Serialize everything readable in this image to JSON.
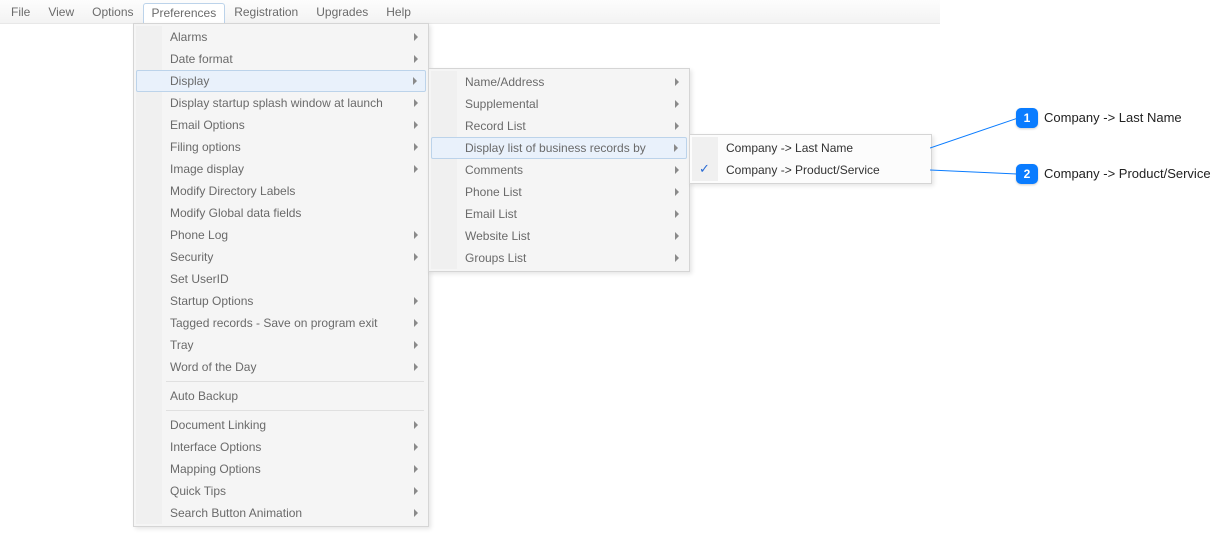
{
  "menubar": {
    "items": [
      {
        "label": "File"
      },
      {
        "label": "View"
      },
      {
        "label": "Options"
      },
      {
        "label": "Preferences",
        "active": true
      },
      {
        "label": "Registration"
      },
      {
        "label": "Upgrades"
      },
      {
        "label": "Help"
      }
    ]
  },
  "prefs_menu": {
    "items": [
      {
        "label": "Alarms",
        "arrow": true
      },
      {
        "label": "Date format",
        "arrow": true
      },
      {
        "label": "Display",
        "arrow": true,
        "highlight": true
      },
      {
        "label": "Display startup splash window at launch",
        "arrow": true
      },
      {
        "label": "Email Options",
        "arrow": true
      },
      {
        "label": "Filing options",
        "arrow": true
      },
      {
        "label": "Image display",
        "arrow": true
      },
      {
        "label": "Modify Directory Labels"
      },
      {
        "label": "Modify Global data fields"
      },
      {
        "label": "Phone Log",
        "arrow": true
      },
      {
        "label": "Security",
        "arrow": true
      },
      {
        "label": "Set UserID"
      },
      {
        "label": "Startup Options",
        "arrow": true
      },
      {
        "label": "Tagged records - Save on program exit",
        "arrow": true
      },
      {
        "label": "Tray",
        "arrow": true
      },
      {
        "label": "Word of the Day",
        "arrow": true
      }
    ],
    "items2": [
      {
        "label": "Auto Backup"
      }
    ],
    "items3": [
      {
        "label": "Document Linking",
        "arrow": true
      },
      {
        "label": "Interface Options",
        "arrow": true
      },
      {
        "label": "Mapping Options",
        "arrow": true
      },
      {
        "label": "Quick Tips",
        "arrow": true
      },
      {
        "label": "Search Button Animation",
        "arrow": true
      }
    ]
  },
  "display_menu": {
    "items": [
      {
        "label": "Name/Address",
        "arrow": true
      },
      {
        "label": "Supplemental",
        "arrow": true
      },
      {
        "label": "Record List",
        "arrow": true
      },
      {
        "label": "Display list of business records by",
        "arrow": true,
        "highlight": true
      },
      {
        "label": "Comments",
        "arrow": true
      },
      {
        "label": "Phone List",
        "arrow": true
      },
      {
        "label": "Email List",
        "arrow": true
      },
      {
        "label": "Website List",
        "arrow": true
      },
      {
        "label": "Groups List",
        "arrow": true
      }
    ]
  },
  "business_menu": {
    "items": [
      {
        "label": "Company -> Last Name"
      },
      {
        "label": "Company -> Product/Service",
        "checked": true
      }
    ]
  },
  "callouts": [
    {
      "num": "1",
      "text": "Company -> Last Name"
    },
    {
      "num": "2",
      "text": "Company -> Product/Service"
    }
  ]
}
